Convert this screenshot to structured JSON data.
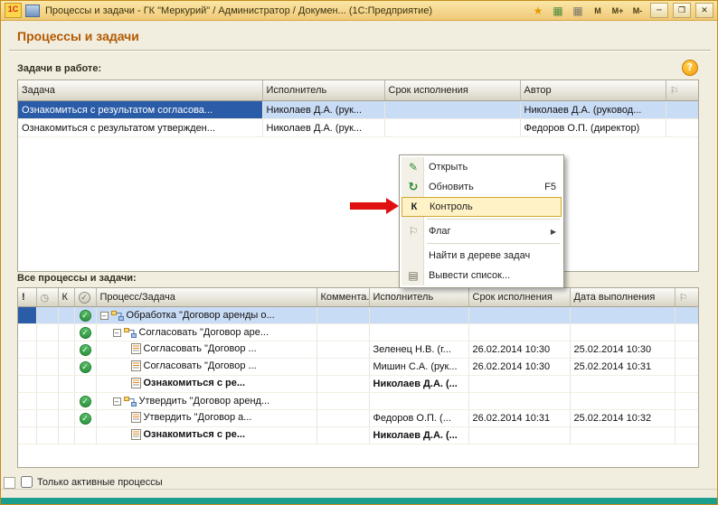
{
  "window": {
    "logo": "1С",
    "title": "Процессы и задачи - ГК \"Меркурий\" / Администратор / Докумен...  (1С:Предприятие)",
    "memory_buttons": {
      "m": "M",
      "m_plus": "M+",
      "m_minus": "M-"
    },
    "controls": {
      "minimize": "─",
      "maximize": "❐",
      "close": "✕"
    }
  },
  "page": {
    "title": "Процессы и задачи"
  },
  "tasks": {
    "label": "Задачи в работе:",
    "columns": {
      "task": "Задача",
      "executor": "Исполнитель",
      "due": "Срок исполнения",
      "author": "Автор"
    },
    "rows": [
      {
        "task": "Ознакомиться с результатом согласова...",
        "executor": "Николаев Д.А. (рук...",
        "due": "",
        "author": "Николаев Д.А. (руковод..."
      },
      {
        "task": "Ознакомиться с результатом утвержден...",
        "executor": "Николаев Д.А. (рук...",
        "due": "",
        "author": "Федоров О.П. (директор)"
      }
    ]
  },
  "menu": {
    "open": "Открыть",
    "refresh": "Обновить",
    "refresh_shortcut": "F5",
    "control": "Контроль",
    "flag": "Флаг",
    "find_in_tree": "Найти в дереве задач",
    "print_list": "Вывести список..."
  },
  "all": {
    "label": "Все процессы и задачи:",
    "columns": {
      "importance": "!",
      "control": "К",
      "task": "Процесс/Задача",
      "comment": "Коммента...",
      "executor": "Исполнитель",
      "due": "Срок исполнения",
      "done": "Дата выполнения"
    },
    "rows": [
      {
        "title": "Обработка \"Договор аренды о...",
        "executor": "",
        "due": "",
        "done": ""
      },
      {
        "title": "Согласовать \"Договор аре...",
        "executor": "",
        "due": "",
        "done": ""
      },
      {
        "title": "Согласовать \"Договор ...",
        "executor": "Зеленец Н.В. (г...",
        "due": "26.02.2014 10:30",
        "done": "25.02.2014 10:30"
      },
      {
        "title": "Согласовать \"Договор ...",
        "executor": "Мишин С.А. (рук...",
        "due": "26.02.2014 10:30",
        "done": "25.02.2014 10:31"
      },
      {
        "title": "Ознакомиться с ре...",
        "executor": "Николаев Д.А. (...",
        "due": "",
        "done": ""
      },
      {
        "title": "Утвердить \"Договор аренд...",
        "executor": "",
        "due": "",
        "done": ""
      },
      {
        "title": "Утвердить \"Договор а...",
        "executor": "Федоров О.П. (...",
        "due": "26.02.2014 10:31",
        "done": "25.02.2014 10:32"
      },
      {
        "title": "Ознакомиться с ре...",
        "executor": "Николаев Д.А. (...",
        "due": "",
        "done": ""
      }
    ]
  },
  "footer": {
    "active_only_label": "Только активные процессы"
  },
  "icons": {
    "help": "?",
    "flag": "⚐",
    "open": "✎",
    "refresh": "↻",
    "control_menu": "К",
    "list": "▤",
    "submenu": "▶",
    "star": "★",
    "calc": "▦",
    "calendar": "▦",
    "status": "◷",
    "check": "✓",
    "expander": "–"
  },
  "colors": {
    "accent": "#B35900",
    "selection": "#2A5CA8",
    "selection_light": "#C9DCF5",
    "check_green": "#3FA44C",
    "arrow_red": "#E01010",
    "teal_bar": "#1B9E8C"
  }
}
